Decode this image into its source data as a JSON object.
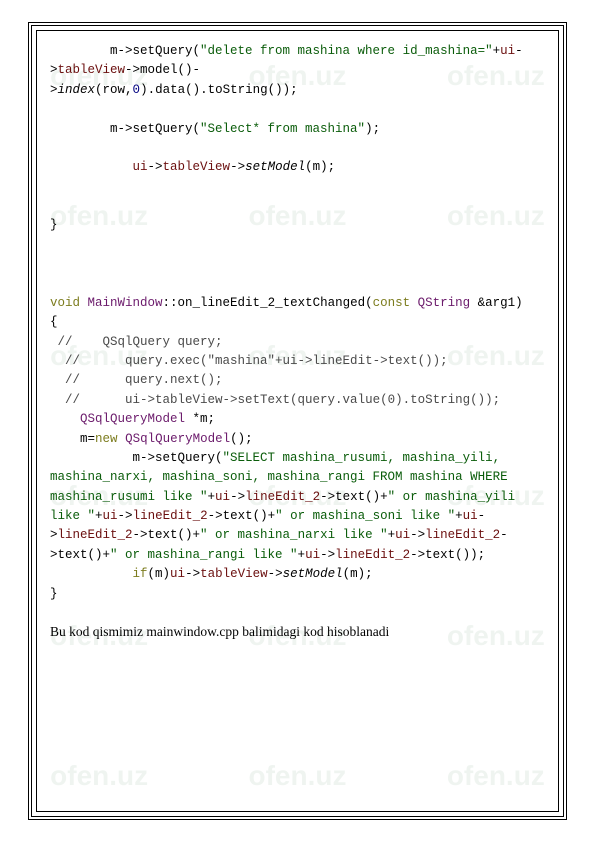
{
  "watermark_text": "ofen.uz",
  "code": {
    "l1a": "        m->setQuery(",
    "l1b": "\"delete from mashina where id_mashina=\"",
    "l1c": "+",
    "l1d": "ui",
    "l1e": "->",
    "l1f": "tableView",
    "l1g": "->model()-",
    "l2a": ">",
    "l2b": "index",
    "l2c": "(row,",
    "l2d": "0",
    "l2e": ").data().toString());",
    "l3a": "        m->setQuery(",
    "l3b": "\"Select* from mashina\"",
    "l3c": ");",
    "l4a": "           ",
    "l4b": "ui",
    "l4c": "->",
    "l4d": "tableView",
    "l4e": "->",
    "l4f": "setModel",
    "l4g": "(m);",
    "l5": "}",
    "l6a": "void",
    "l6b": " ",
    "l6c": "MainWindow",
    "l6d": "::on_lineEdit_2_textChanged(",
    "l6e": "const",
    "l6f": " ",
    "l6g": "QString",
    "l6h": " &arg1)",
    "l7": "{",
    "l8": " //    QSqlQuery query;",
    "l9": "  //      query.exec(\"mashina\"+ui->lineEdit->text());",
    "l10": "  //      query.next();",
    "l11": "  //      ui->tableView->setText(query.value(0).toString());",
    "l12a": "    ",
    "l12b": "QSqlQueryModel",
    "l12c": " *m;",
    "l13a": "    m=",
    "l13b": "new",
    "l13c": " ",
    "l13d": "QSqlQueryModel",
    "l13e": "();",
    "l14a": "           m->setQuery(",
    "l14b": "\"SELECT mashina_rusumi, mashina_yili, mashina_narxi, mashina_soni, mashina_rangi FROM mashina WHERE  mashina_rusumi like \"",
    "l14c": "+",
    "l14d": "ui",
    "l14e": "->",
    "l14f": "lineEdit_2",
    "l14g": "->text()+",
    "l14h": "\" or mashina_yili like \"",
    "l14i": "+",
    "l14j": "ui",
    "l14k": "->",
    "l14l": "lineEdit_2",
    "l14m": "->text()+",
    "l14n": "\" or mashina_soni like \"",
    "l14o": "+",
    "l14p": "ui",
    "l14q": "->",
    "l14r": "lineEdit_2",
    "l14s": "->text()+",
    "l14t": "\" or mashina_narxi like \"",
    "l14u": "+",
    "l14v": "ui",
    "l14w": "->",
    "l14x": "lineEdit_2",
    "l14y": "->text()+",
    "l14z": "\" or mashina_rangi like \"",
    "l14aa": "+",
    "l14ab": "ui",
    "l14ac": "->",
    "l14ad": "lineEdit_2",
    "l14ae": "->text());",
    "l15a": "           ",
    "l15b": "if",
    "l15c": "(m)",
    "l15d": "ui",
    "l15e": "->",
    "l15f": "tableView",
    "l15g": "->",
    "l15h": "setModel",
    "l15i": "(m);",
    "l16": "}"
  },
  "paragraph": "Bu kod qismimiz mainwindow.cpp balimidagi kod hisoblanadi"
}
